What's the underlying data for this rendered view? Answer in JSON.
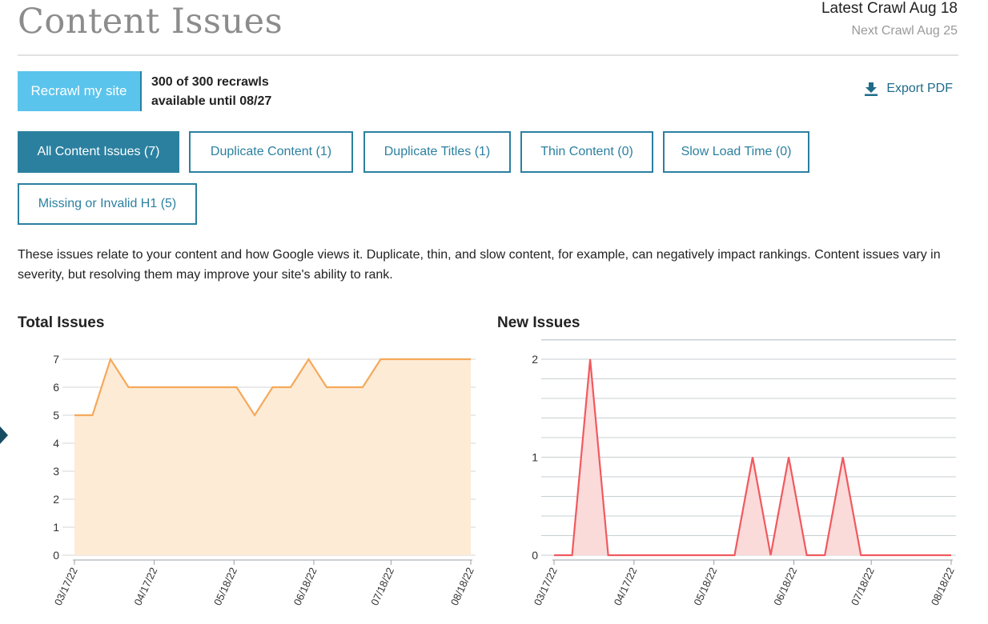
{
  "header": {
    "title": "Content Issues",
    "latest_crawl": "Latest Crawl Aug 18",
    "next_crawl": "Next Crawl Aug 25"
  },
  "recrawl": {
    "button_label": "Recrawl my site",
    "count_text": "300 of 300 recrawls",
    "available_text": "available until 08/27"
  },
  "export": {
    "label": "Export PDF",
    "icon": "download-icon"
  },
  "filters": [
    {
      "label": "All Content Issues (7)",
      "active": true
    },
    {
      "label": "Duplicate Content (1)",
      "active": false
    },
    {
      "label": "Duplicate Titles (1)",
      "active": false
    },
    {
      "label": "Thin Content (0)",
      "active": false
    },
    {
      "label": "Slow Load Time (0)",
      "active": false
    },
    {
      "label": "Missing or Invalid H1 (5)",
      "active": false
    }
  ],
  "description": "These issues relate to your content and how Google views it. Duplicate, thin, and slow content, for example, can negatively impact rankings. Content issues vary in severity, but resolving them may improve your site's ability to rank.",
  "colors": {
    "accent": "#2b80a0",
    "recrawl_button": "#5bc4ec",
    "total_line": "#f5a95a",
    "total_fill": "#fdebd6",
    "new_line": "#ef5a5f",
    "new_fill": "#fbdada"
  },
  "chart_data": [
    {
      "type": "area",
      "title": "Total Issues",
      "x_ticks": [
        "03/17/22",
        "04/17/22",
        "05/18/22",
        "06/18/22",
        "07/18/22",
        "08/18/22"
      ],
      "x": [
        "03/17/22",
        "03/24/22",
        "03/31/22",
        "04/07/22",
        "04/14/22",
        "04/21/22",
        "04/28/22",
        "05/05/22",
        "05/12/22",
        "05/19/22",
        "05/26/22",
        "06/02/22",
        "06/09/22",
        "06/16/22",
        "06/23/22",
        "06/30/22",
        "07/07/22",
        "07/14/22",
        "07/21/22",
        "07/28/22",
        "08/04/22",
        "08/11/22",
        "08/18/22"
      ],
      "values": [
        5,
        5,
        7,
        6,
        6,
        6,
        6,
        6,
        6,
        6,
        5,
        6,
        6,
        7,
        6,
        6,
        6,
        7,
        7,
        7,
        7,
        7,
        7
      ],
      "ylim": [
        0,
        7
      ],
      "y_ticks": [
        0,
        1,
        2,
        3,
        4,
        5,
        6,
        7
      ],
      "grid": true
    },
    {
      "type": "area",
      "title": "New Issues",
      "x_ticks": [
        "03/17/22",
        "04/17/22",
        "05/18/22",
        "06/18/22",
        "07/18/22",
        "08/18/22"
      ],
      "x": [
        "03/17/22",
        "03/24/22",
        "03/31/22",
        "04/07/22",
        "04/14/22",
        "04/21/22",
        "04/28/22",
        "05/05/22",
        "05/12/22",
        "05/19/22",
        "05/26/22",
        "06/02/22",
        "06/09/22",
        "06/16/22",
        "06/23/22",
        "06/30/22",
        "07/07/22",
        "07/14/22",
        "07/21/22",
        "07/28/22",
        "08/04/22",
        "08/11/22",
        "08/18/22"
      ],
      "values": [
        0,
        0,
        2,
        0,
        0,
        0,
        0,
        0,
        0,
        0,
        0,
        1,
        0,
        1,
        0,
        0,
        1,
        0,
        0,
        0,
        0,
        0,
        0
      ],
      "ylim": [
        0,
        2
      ],
      "y_ticks": [
        0,
        1,
        2
      ],
      "grid": true
    }
  ]
}
